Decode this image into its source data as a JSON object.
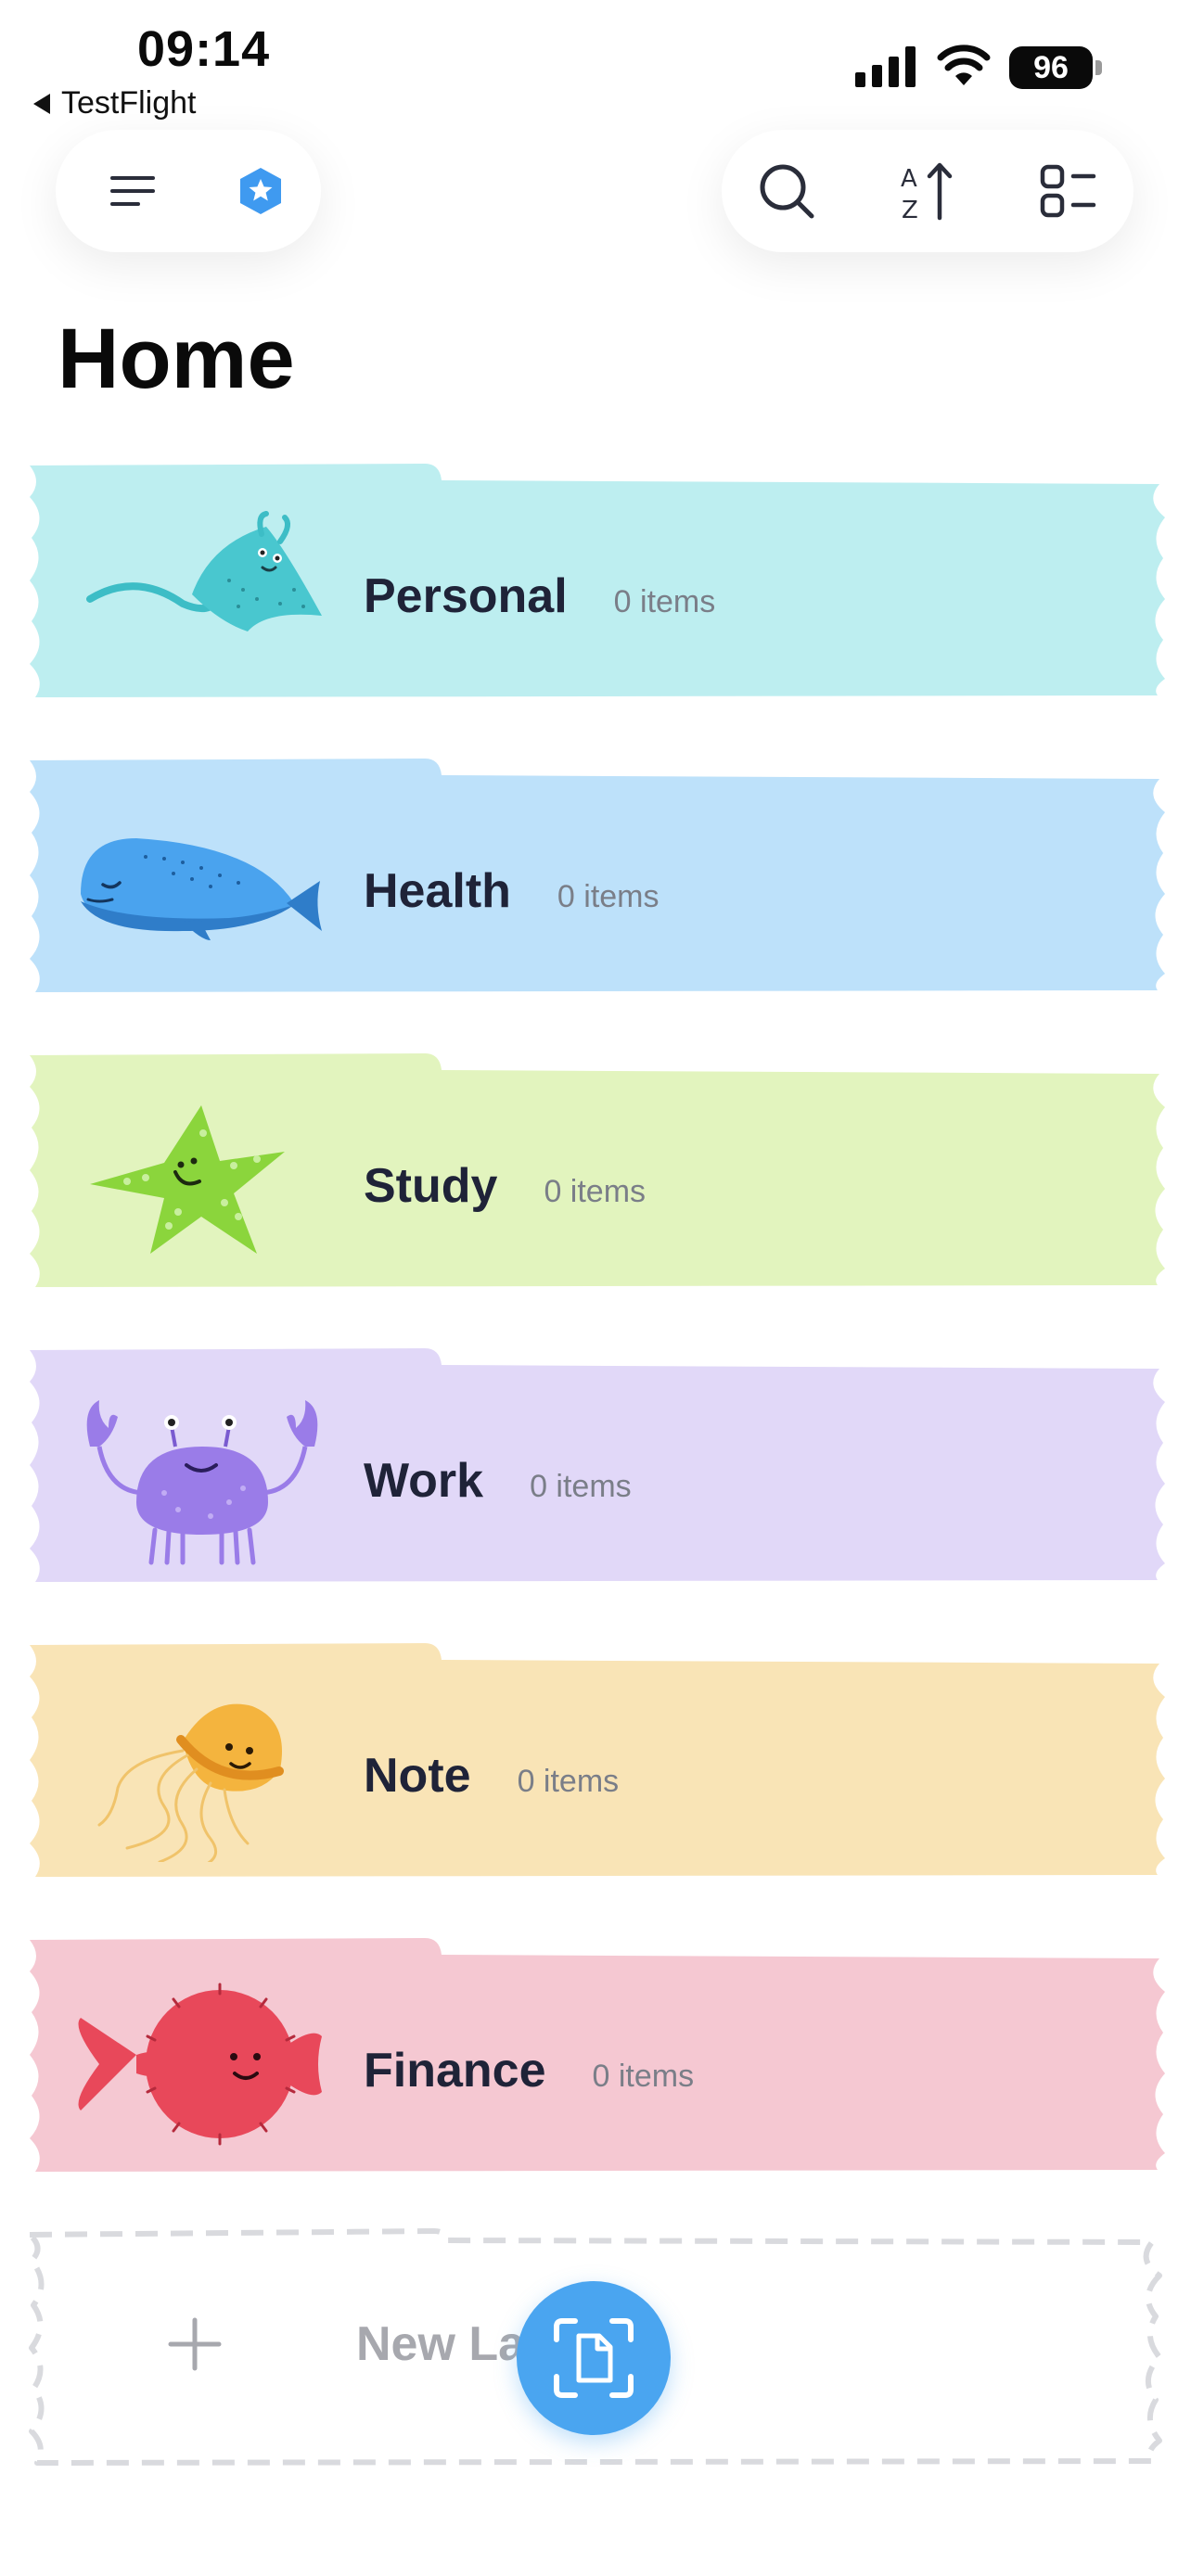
{
  "status_bar": {
    "time": "09:14",
    "back_app": "TestFlight",
    "battery": "96"
  },
  "header": {
    "menu_icon": "hamburger-icon",
    "badge_icon": "star-badge-icon",
    "search_icon": "search-icon",
    "sort_icon": "sort-az-icon",
    "view_icon": "list-view-icon"
  },
  "page": {
    "title": "Home"
  },
  "labels": [
    {
      "name": "Personal",
      "count": "0 items",
      "color": "#bdeef0",
      "animal": "manta-ray-icon"
    },
    {
      "name": "Health",
      "count": "0 items",
      "color": "#bde1fa",
      "animal": "whale-icon"
    },
    {
      "name": "Study",
      "count": "0 items",
      "color": "#e2f4be",
      "animal": "starfish-icon"
    },
    {
      "name": "Work",
      "count": "0 items",
      "color": "#e1d8f8",
      "animal": "crab-icon"
    },
    {
      "name": "Note",
      "count": "0 items",
      "color": "#f9e4b6",
      "animal": "jellyfish-icon"
    },
    {
      "name": "Finance",
      "count": "0 items",
      "color": "#f5c8d2",
      "animal": "pufferfish-icon"
    }
  ],
  "new_label": {
    "text": "New La",
    "icon": "plus-icon"
  },
  "fab": {
    "icon": "scan-document-icon",
    "color": "#4aa5f0"
  }
}
